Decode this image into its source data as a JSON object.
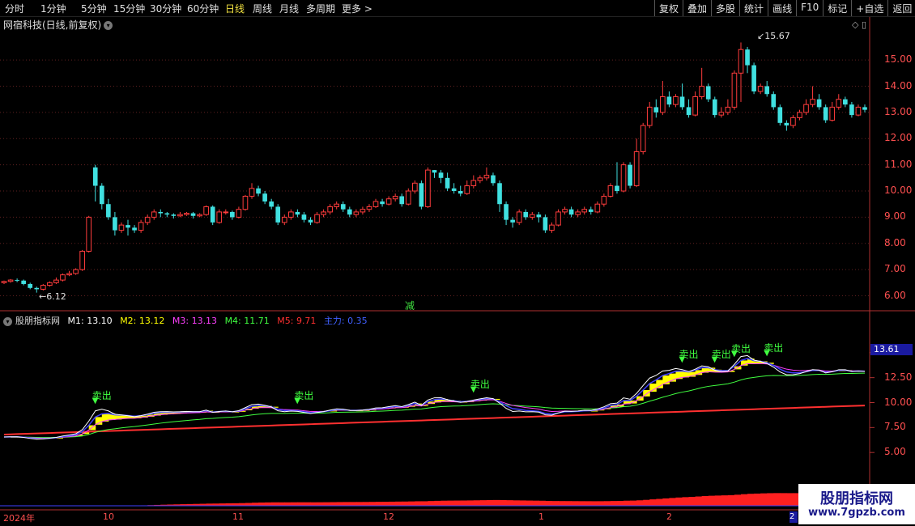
{
  "toolbar": {
    "periods": [
      "分时",
      "1分钟",
      "5分钟",
      "15分钟",
      "30分钟",
      "60分钟",
      "日线",
      "周线",
      "月线",
      "多周期",
      "更多 >"
    ],
    "active_period": "日线",
    "right_buttons": [
      "复权",
      "叠加",
      "多股",
      "统计",
      "画线",
      "F10",
      "标记",
      "+自选",
      "返回"
    ]
  },
  "stock": {
    "title": "网宿科技(日线,前复权)",
    "high_label": "15.67",
    "low_label": "6.12",
    "event_mark": "减"
  },
  "price_axis": [
    "15.00",
    "14.00",
    "13.00",
    "12.00",
    "11.00",
    "10.00",
    "9.00",
    "8.00",
    "7.00",
    "6.00"
  ],
  "indicator": {
    "name": "股朋指标网",
    "m1": "M1: 13.10",
    "m2": "M2: 13.12",
    "m3": "M3: 13.13",
    "m4": "M4: 11.71",
    "m5": "M5: 9.71",
    "main": "主力: 0.35",
    "axis": [
      "15.00",
      "12.50",
      "10.00",
      "7.50",
      "5.00"
    ],
    "last_value": "13.61",
    "sell_label": "卖出",
    "colors": {
      "m1": "#ffffff",
      "m2": "#ffff00",
      "m3": "#ff40ff",
      "m4": "#40ff40",
      "m5": "#ff3030",
      "main": "#4040ff"
    }
  },
  "time_axis": [
    "2024年",
    "10",
    "11",
    "12",
    "1",
    "2",
    "2"
  ],
  "watermark": {
    "name": "股朋指标网",
    "url": "www.7gpzb.com"
  },
  "chart_data": {
    "type": "candlestick",
    "ylim": [
      5.8,
      15.9
    ],
    "candles": [
      [
        6.5,
        6.55,
        6.45,
        6.58
      ],
      [
        6.55,
        6.6,
        6.5,
        6.64
      ],
      [
        6.6,
        6.58,
        6.52,
        6.66
      ],
      [
        6.58,
        6.45,
        6.4,
        6.62
      ],
      [
        6.45,
        6.3,
        6.25,
        6.5
      ],
      [
        6.3,
        6.25,
        6.12,
        6.35
      ],
      [
        6.25,
        6.4,
        6.2,
        6.45
      ],
      [
        6.4,
        6.5,
        6.35,
        6.55
      ],
      [
        6.5,
        6.6,
        6.45,
        6.7
      ],
      [
        6.6,
        6.8,
        6.55,
        6.85
      ],
      [
        6.8,
        6.85,
        6.75,
        6.95
      ],
      [
        6.85,
        7.0,
        6.8,
        7.05
      ],
      [
        7.0,
        7.7,
        6.95,
        7.75
      ],
      [
        7.7,
        9.0,
        7.65,
        9.05
      ],
      [
        10.9,
        10.2,
        9.6,
        11.0
      ],
      [
        10.2,
        9.5,
        9.3,
        10.3
      ],
      [
        9.5,
        9.0,
        8.9,
        9.7
      ],
      [
        9.0,
        8.5,
        8.3,
        9.2
      ],
      [
        8.5,
        8.7,
        8.4,
        8.8
      ],
      [
        8.7,
        8.6,
        8.3,
        8.9
      ],
      [
        8.6,
        8.5,
        8.4,
        8.7
      ],
      [
        8.5,
        8.8,
        8.4,
        8.9
      ],
      [
        8.8,
        9.0,
        8.7,
        9.1
      ],
      [
        9.0,
        9.2,
        8.9,
        9.3
      ],
      [
        9.2,
        9.15,
        9.0,
        9.3
      ],
      [
        9.15,
        9.1,
        9.0,
        9.2
      ],
      [
        9.1,
        9.05,
        8.95,
        9.15
      ],
      [
        9.05,
        9.1,
        9.0,
        9.2
      ],
      [
        9.1,
        9.15,
        9.05,
        9.2
      ],
      [
        9.15,
        9.05,
        8.95,
        9.2
      ],
      [
        9.05,
        9.1,
        9.0,
        9.15
      ],
      [
        9.1,
        9.4,
        9.05,
        9.45
      ],
      [
        9.4,
        8.8,
        8.7,
        9.45
      ],
      [
        8.8,
        9.2,
        8.75,
        9.3
      ],
      [
        9.2,
        9.2,
        9.1,
        9.3
      ],
      [
        9.2,
        9.0,
        8.9,
        9.25
      ],
      [
        9.0,
        9.3,
        8.95,
        9.4
      ],
      [
        9.3,
        9.8,
        9.25,
        9.85
      ],
      [
        9.8,
        10.1,
        9.7,
        10.3
      ],
      [
        10.1,
        9.9,
        9.8,
        10.2
      ],
      [
        9.9,
        9.6,
        9.5,
        10.0
      ],
      [
        9.6,
        9.4,
        9.3,
        9.7
      ],
      [
        9.4,
        8.8,
        8.7,
        9.5
      ],
      [
        8.8,
        9.0,
        8.7,
        9.1
      ],
      [
        9.0,
        9.2,
        8.9,
        9.3
      ],
      [
        9.2,
        9.1,
        9.0,
        9.3
      ],
      [
        9.1,
        8.9,
        8.8,
        9.2
      ],
      [
        8.9,
        8.8,
        8.7,
        9.0
      ],
      [
        8.8,
        9.1,
        8.75,
        9.2
      ],
      [
        9.1,
        9.2,
        9.0,
        9.3
      ],
      [
        9.2,
        9.4,
        9.1,
        9.5
      ],
      [
        9.4,
        9.5,
        9.3,
        9.6
      ],
      [
        9.5,
        9.3,
        9.2,
        9.6
      ],
      [
        9.3,
        9.1,
        9.0,
        9.4
      ],
      [
        9.1,
        9.2,
        9.0,
        9.3
      ],
      [
        9.2,
        9.3,
        9.1,
        9.4
      ],
      [
        9.3,
        9.4,
        9.2,
        9.5
      ],
      [
        9.4,
        9.6,
        9.35,
        9.7
      ],
      [
        9.6,
        9.5,
        9.4,
        9.7
      ],
      [
        9.5,
        9.7,
        9.45,
        9.8
      ],
      [
        9.7,
        9.8,
        9.6,
        9.9
      ],
      [
        9.8,
        9.5,
        9.4,
        9.9
      ],
      [
        9.5,
        10.0,
        9.45,
        10.1
      ],
      [
        10.0,
        10.3,
        9.9,
        10.4
      ],
      [
        10.3,
        9.4,
        9.3,
        10.4
      ],
      [
        9.4,
        10.8,
        9.35,
        10.9
      ],
      [
        10.8,
        10.7,
        10.5,
        10.8
      ],
      [
        10.7,
        10.5,
        10.3,
        10.8
      ],
      [
        10.5,
        10.1,
        10.0,
        10.7
      ],
      [
        10.1,
        10.0,
        9.9,
        10.3
      ],
      [
        10.0,
        9.9,
        9.8,
        10.2
      ],
      [
        9.9,
        10.2,
        9.85,
        10.4
      ],
      [
        10.2,
        10.4,
        10.1,
        10.6
      ],
      [
        10.4,
        10.5,
        10.3,
        10.6
      ],
      [
        10.5,
        10.6,
        10.4,
        10.9
      ],
      [
        10.6,
        10.3,
        10.2,
        10.7
      ],
      [
        10.3,
        9.5,
        9.2,
        10.4
      ],
      [
        9.5,
        8.9,
        8.7,
        9.6
      ],
      [
        8.9,
        8.8,
        8.6,
        9.0
      ],
      [
        8.8,
        9.2,
        8.7,
        9.3
      ],
      [
        9.2,
        9.0,
        8.9,
        9.3
      ],
      [
        9.0,
        9.1,
        8.9,
        9.2
      ],
      [
        9.1,
        9.0,
        8.8,
        9.2
      ],
      [
        9.0,
        8.5,
        8.4,
        9.1
      ],
      [
        8.5,
        8.7,
        8.4,
        8.8
      ],
      [
        8.7,
        9.2,
        8.65,
        9.3
      ],
      [
        9.2,
        9.3,
        9.1,
        9.4
      ],
      [
        9.3,
        9.1,
        9.0,
        9.4
      ],
      [
        9.1,
        9.2,
        9.0,
        9.3
      ],
      [
        9.2,
        9.3,
        9.1,
        9.4
      ],
      [
        9.3,
        9.2,
        9.1,
        9.4
      ],
      [
        9.2,
        9.5,
        9.15,
        9.6
      ],
      [
        9.5,
        9.8,
        9.4,
        9.9
      ],
      [
        9.8,
        10.2,
        9.75,
        10.3
      ],
      [
        10.2,
        10.0,
        9.9,
        11.1
      ],
      [
        10.0,
        11.0,
        9.95,
        11.1
      ],
      [
        11.0,
        10.2,
        10.1,
        11.1
      ],
      [
        10.2,
        11.5,
        10.15,
        12.0
      ],
      [
        11.5,
        12.5,
        11.4,
        12.6
      ],
      [
        12.5,
        13.2,
        12.4,
        13.4
      ],
      [
        13.2,
        13.0,
        12.8,
        13.5
      ],
      [
        13.0,
        13.6,
        12.9,
        14.2
      ],
      [
        13.6,
        13.3,
        13.2,
        13.8
      ],
      [
        13.3,
        13.6,
        13.2,
        13.7
      ],
      [
        13.6,
        13.2,
        13.1,
        14.1
      ],
      [
        13.2,
        12.9,
        12.8,
        13.5
      ],
      [
        12.9,
        13.6,
        12.85,
        13.8
      ],
      [
        13.6,
        14.0,
        13.5,
        14.7
      ],
      [
        14.0,
        13.5,
        13.4,
        14.1
      ],
      [
        13.5,
        12.9,
        12.8,
        13.6
      ],
      [
        12.9,
        13.0,
        12.8,
        13.2
      ],
      [
        13.0,
        13.2,
        12.9,
        13.5
      ],
      [
        13.2,
        14.5,
        13.1,
        14.6
      ],
      [
        14.5,
        15.4,
        13.4,
        15.67
      ],
      [
        15.4,
        14.8,
        14.5,
        15.5
      ],
      [
        14.8,
        13.8,
        13.7,
        14.9
      ],
      [
        13.8,
        14.0,
        13.7,
        14.1
      ],
      [
        14.0,
        13.7,
        13.6,
        14.2
      ],
      [
        13.7,
        13.2,
        13.1,
        13.8
      ],
      [
        13.2,
        12.6,
        12.5,
        13.3
      ],
      [
        12.6,
        12.5,
        12.3,
        12.7
      ],
      [
        12.5,
        12.8,
        12.4,
        12.9
      ],
      [
        12.8,
        13.0,
        12.7,
        13.1
      ],
      [
        13.0,
        13.3,
        12.9,
        13.5
      ],
      [
        13.3,
        13.5,
        13.2,
        14.0
      ],
      [
        13.5,
        13.2,
        13.1,
        13.7
      ],
      [
        13.2,
        12.7,
        12.6,
        13.3
      ],
      [
        12.7,
        13.2,
        12.65,
        13.4
      ],
      [
        13.2,
        13.5,
        13.1,
        13.7
      ],
      [
        13.5,
        13.3,
        13.2,
        13.6
      ],
      [
        13.3,
        12.9,
        12.8,
        13.4
      ],
      [
        12.9,
        13.2,
        12.85,
        13.3
      ],
      [
        13.2,
        13.1,
        13.0,
        13.3
      ]
    ]
  }
}
